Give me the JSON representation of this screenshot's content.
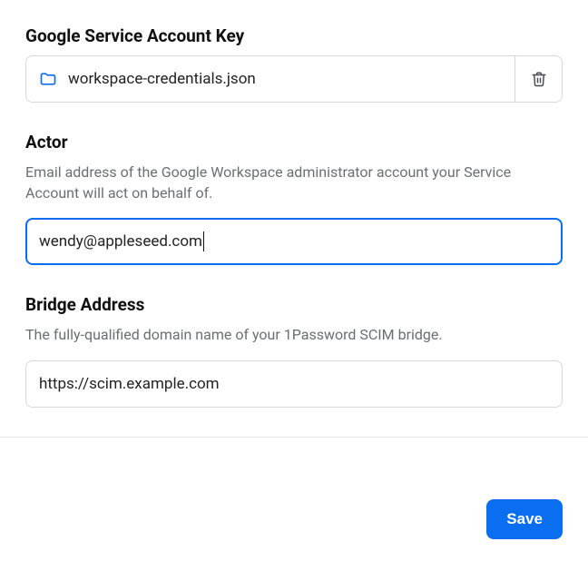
{
  "serviceKey": {
    "label": "Google Service Account Key",
    "filename": "workspace-credentials.json"
  },
  "actor": {
    "label": "Actor",
    "description": "Email address of the Google Workspace administrator account your Service Account will act on behalf of.",
    "value": "wendy@appleseed.com"
  },
  "bridge": {
    "label": "Bridge Address",
    "description": "The fully-qualified domain name of your 1Password SCIM bridge.",
    "value": "https://scim.example.com"
  },
  "footer": {
    "save_label": "Save"
  }
}
